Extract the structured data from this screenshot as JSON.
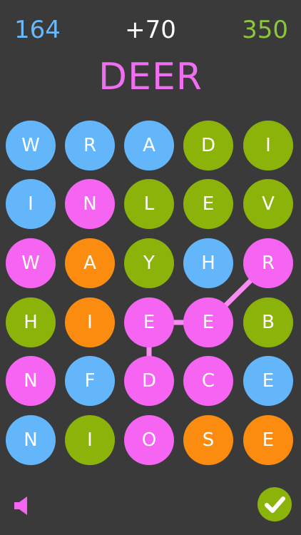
{
  "header": {
    "score_left": "164",
    "score_delta": "+70",
    "score_right": "350"
  },
  "current_word": "DEER",
  "colors": {
    "background": "#3a3a3a",
    "blue": "#64b6fb",
    "green": "#8cb30a",
    "pink": "#f565f2",
    "orange": "#fb8c0f",
    "score_left": "#6ab8f8",
    "score_delta": "#ffffff",
    "score_right": "#8cc63e",
    "word": "#f06ef0",
    "path": "#f98bf3"
  },
  "board": {
    "rows": [
      [
        {
          "letter": "W",
          "color": "blue"
        },
        {
          "letter": "R",
          "color": "blue"
        },
        {
          "letter": "A",
          "color": "blue"
        },
        {
          "letter": "D",
          "color": "green"
        },
        {
          "letter": "I",
          "color": "green"
        }
      ],
      [
        {
          "letter": "I",
          "color": "blue"
        },
        {
          "letter": "N",
          "color": "pink"
        },
        {
          "letter": "L",
          "color": "green"
        },
        {
          "letter": "E",
          "color": "green"
        },
        {
          "letter": "V",
          "color": "green"
        }
      ],
      [
        {
          "letter": "W",
          "color": "pink"
        },
        {
          "letter": "A",
          "color": "orange"
        },
        {
          "letter": "Y",
          "color": "green"
        },
        {
          "letter": "H",
          "color": "blue"
        },
        {
          "letter": "R",
          "color": "pink"
        }
      ],
      [
        {
          "letter": "H",
          "color": "green"
        },
        {
          "letter": "I",
          "color": "orange"
        },
        {
          "letter": "E",
          "color": "pink"
        },
        {
          "letter": "E",
          "color": "pink"
        },
        {
          "letter": "B",
          "color": "green"
        }
      ],
      [
        {
          "letter": "N",
          "color": "pink"
        },
        {
          "letter": "F",
          "color": "blue"
        },
        {
          "letter": "D",
          "color": "pink"
        },
        {
          "letter": "C",
          "color": "pink"
        },
        {
          "letter": "E",
          "color": "blue"
        }
      ],
      [
        {
          "letter": "N",
          "color": "blue"
        },
        {
          "letter": "I",
          "color": "green"
        },
        {
          "letter": "O",
          "color": "pink"
        },
        {
          "letter": "S",
          "color": "orange"
        },
        {
          "letter": "E",
          "color": "orange"
        }
      ]
    ],
    "selected_path": [
      [
        4,
        2
      ],
      [
        3,
        2
      ],
      [
        3,
        3
      ],
      [
        2,
        4
      ]
    ]
  },
  "footer": {
    "sound_icon": "speaker-icon",
    "check_icon": "checkmark-icon",
    "sound_color": "#f565f2",
    "check_bg": "#8cb30a"
  }
}
